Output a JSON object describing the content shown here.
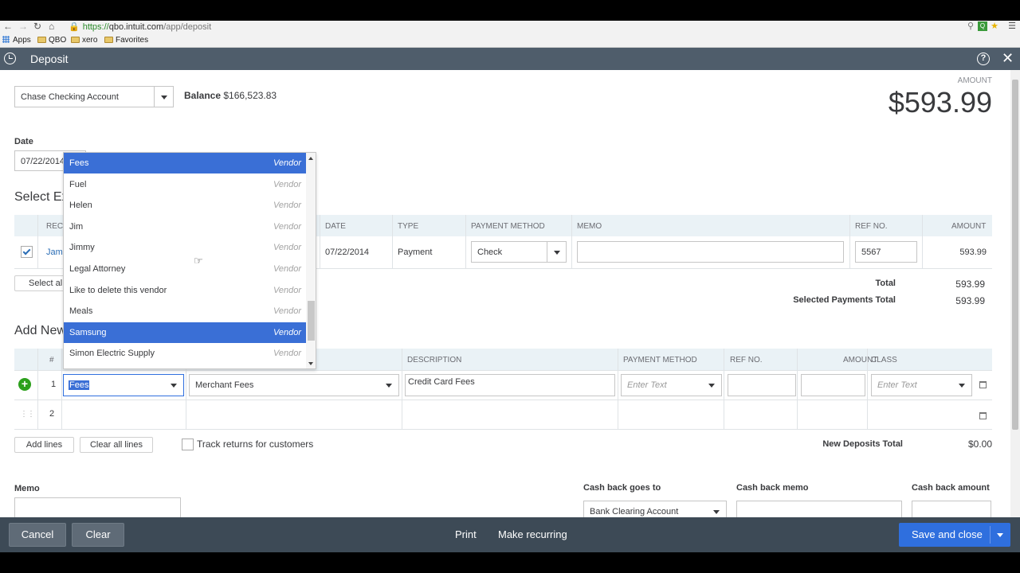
{
  "browser": {
    "url_prefix": "https://",
    "url_host": "qbo.intuit.com",
    "url_path": "/app/deposit",
    "bookmarks": [
      "Apps",
      "QBO",
      "xero",
      "Favorites"
    ]
  },
  "app": {
    "title": "Deposit",
    "account": "Chase Checking Account",
    "balance_label": "Balance",
    "balance_value": "$166,523.83",
    "amount_label": "AMOUNT",
    "amount_value": "$593.99",
    "date_label": "Date",
    "date_value": "07/22/2014"
  },
  "existing": {
    "heading": "Select Ex",
    "columns": {
      "rec": "REC",
      "date": "DATE",
      "type": "TYPE",
      "payment_method": "PAYMENT METHOD",
      "memo": "MEMO",
      "ref_no": "REF NO.",
      "amount": "AMOUNT"
    },
    "row": {
      "name": "Jam",
      "date": "07/22/2014",
      "type": "Payment",
      "payment_method": "Check",
      "ref_no": "5567",
      "amount": "593.99"
    },
    "select_all": "Select all",
    "total_label": "Total",
    "total_value": "593.99",
    "selected_label": "Selected Payments Total",
    "selected_value": "593.99"
  },
  "new_deposits": {
    "heading": "Add New",
    "columns": {
      "num": "#",
      "description": "DESCRIPTION",
      "payment_method": "PAYMENT METHOD",
      "ref_no": "REF NO.",
      "amount": "AMOUNT",
      "class": "CLASS"
    },
    "row1": {
      "num": "1",
      "received_from": "Fees",
      "account": "Merchant Fees",
      "description": "Credit Card Fees",
      "payment_method_ph": "Enter Text",
      "class_ph": "Enter Text"
    },
    "row2": {
      "num": "2"
    },
    "add_lines": "Add lines",
    "clear_lines": "Clear all lines",
    "track_returns": "Track returns for customers",
    "total_label": "New Deposits Total",
    "total_value": "$0.00"
  },
  "dropdown": {
    "items": [
      {
        "name": "Fees",
        "type": "Vendor",
        "selected": true
      },
      {
        "name": "Fuel",
        "type": "Vendor"
      },
      {
        "name": "Helen",
        "type": "Vendor"
      },
      {
        "name": "Jim",
        "type": "Vendor"
      },
      {
        "name": "Jimmy",
        "type": "Vendor"
      },
      {
        "name": "Legal Attorney",
        "type": "Vendor"
      },
      {
        "name": "Like to delete this vendor",
        "type": "Vendor"
      },
      {
        "name": "Meals",
        "type": "Vendor"
      },
      {
        "name": "Samsung",
        "type": "Vendor",
        "selected": true
      },
      {
        "name": "Simon Electric Supply",
        "type": "Vendor"
      }
    ]
  },
  "bottom_fields": {
    "memo_label": "Memo",
    "cashback_to_label": "Cash back goes to",
    "cashback_to_value": "Bank Clearing Account",
    "cashback_memo_label": "Cash back memo",
    "cashback_amount_label": "Cash back amount"
  },
  "footer": {
    "cancel": "Cancel",
    "clear": "Clear",
    "print": "Print",
    "recurring": "Make recurring",
    "save": "Save and close"
  },
  "colors": {
    "header": "#4f5d6b",
    "footer": "#3d4a56",
    "accent": "#2f6fde",
    "selection": "#3a6fd6",
    "add_green": "#2ca01c"
  }
}
